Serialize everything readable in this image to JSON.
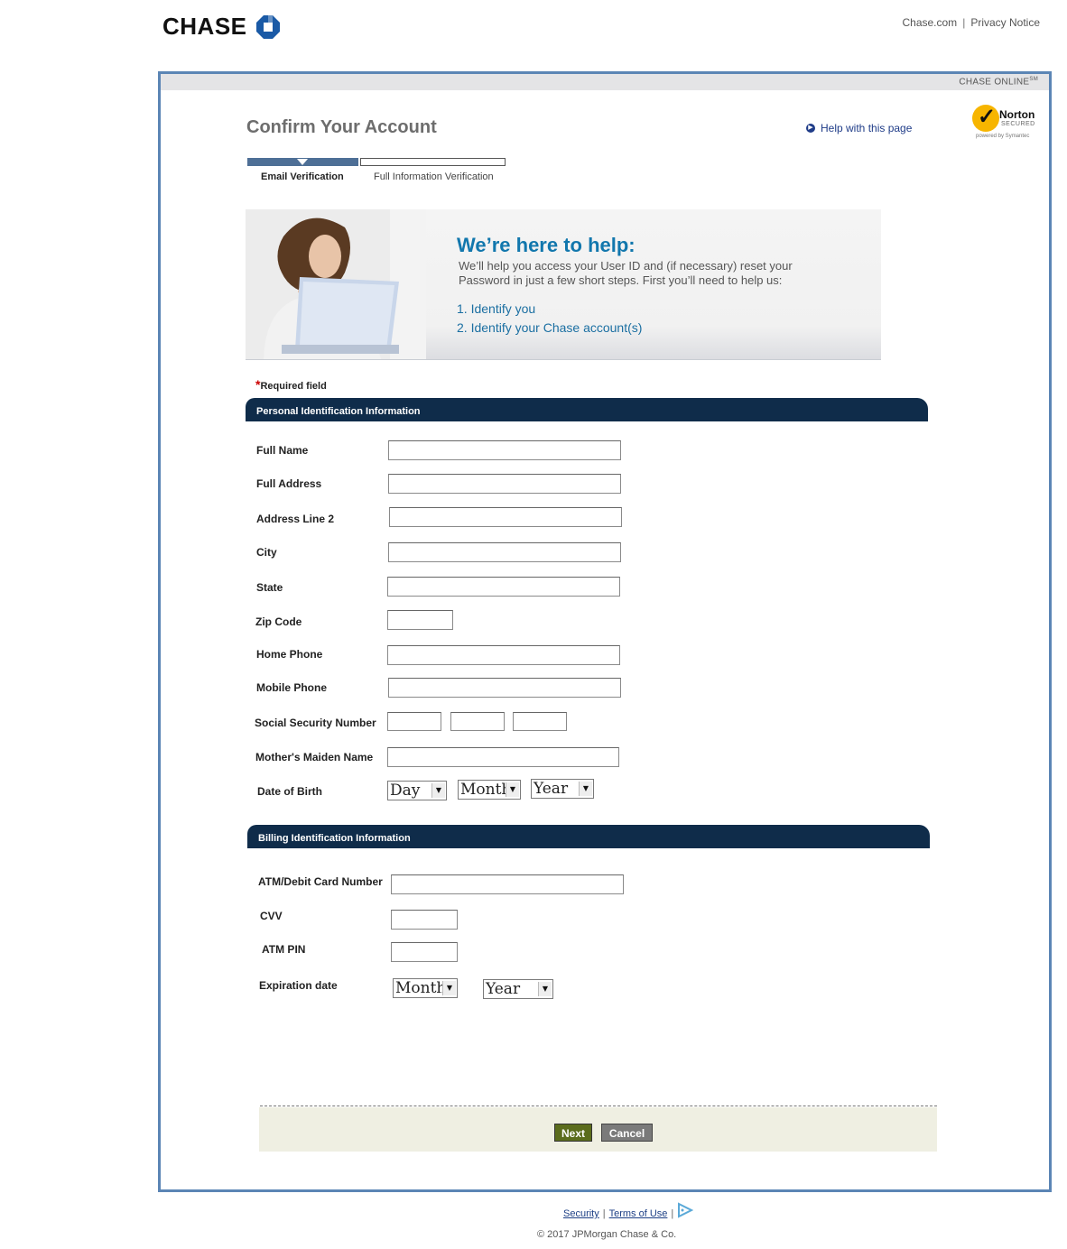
{
  "header": {
    "logo_text": "CHASE",
    "links": [
      "Chase.com",
      "Privacy Notice"
    ],
    "separator": "|"
  },
  "topbar": {
    "label": "CHASE ONLINE",
    "mark": "SM"
  },
  "page": {
    "title": "Confirm Your Account",
    "help_link": "Help with this page"
  },
  "norton": {
    "name": "Norton",
    "secured": "SECURED",
    "powered": "powered by Symantec"
  },
  "steps": [
    {
      "label": "Email Verification",
      "active": true
    },
    {
      "label": "Full Information Verification",
      "active": false
    }
  ],
  "banner": {
    "title": "We’re here to help:",
    "text": "We’ll help you access your User ID and (if necessary) reset your Password in just a few short steps. First you’ll need to help us:",
    "items": [
      "1. Identify you",
      "2. Identify your Chase account(s)"
    ]
  },
  "required_note": {
    "star": "*",
    "text": "Required field"
  },
  "personal_section": {
    "title": "Personal Identification Information",
    "fields": {
      "full_name": "Full Name",
      "full_address": "Full Address",
      "address_line2": "Address Line 2",
      "city": "City",
      "state": "State",
      "zip": "Zip Code",
      "home_phone": "Home Phone",
      "mobile_phone": "Mobile Phone",
      "ssn": "Social Security Number",
      "maiden": "Mother's Maiden Name",
      "dob": "Date of Birth"
    },
    "dob_selects": {
      "day": "Day",
      "month": "Month",
      "year": "Year"
    }
  },
  "billing_section": {
    "title": "Billing Identification Information",
    "fields": {
      "card": "ATM/Debit Card Number",
      "cvv": "CVV",
      "pin": "ATM PIN",
      "expiration": "Expiration date"
    },
    "exp_selects": {
      "month": "Month",
      "year": "Year"
    }
  },
  "buttons": {
    "next": "Next",
    "cancel": "Cancel"
  },
  "footer": {
    "links": [
      "Security",
      "Terms of Use"
    ],
    "separator": "|",
    "copyright": "© 2017 JPMorgan Chase & Co."
  },
  "colors": {
    "frame": "#5b85b5",
    "section_bar": "#0f2c4a",
    "banner_title": "#1277ad",
    "next_button": "#5b6c1c",
    "cancel_button": "#7a7a7a"
  },
  "icons": [
    "chase-octagon-icon",
    "help-arrow-icon",
    "norton-check-icon",
    "adchoices-icon"
  ]
}
